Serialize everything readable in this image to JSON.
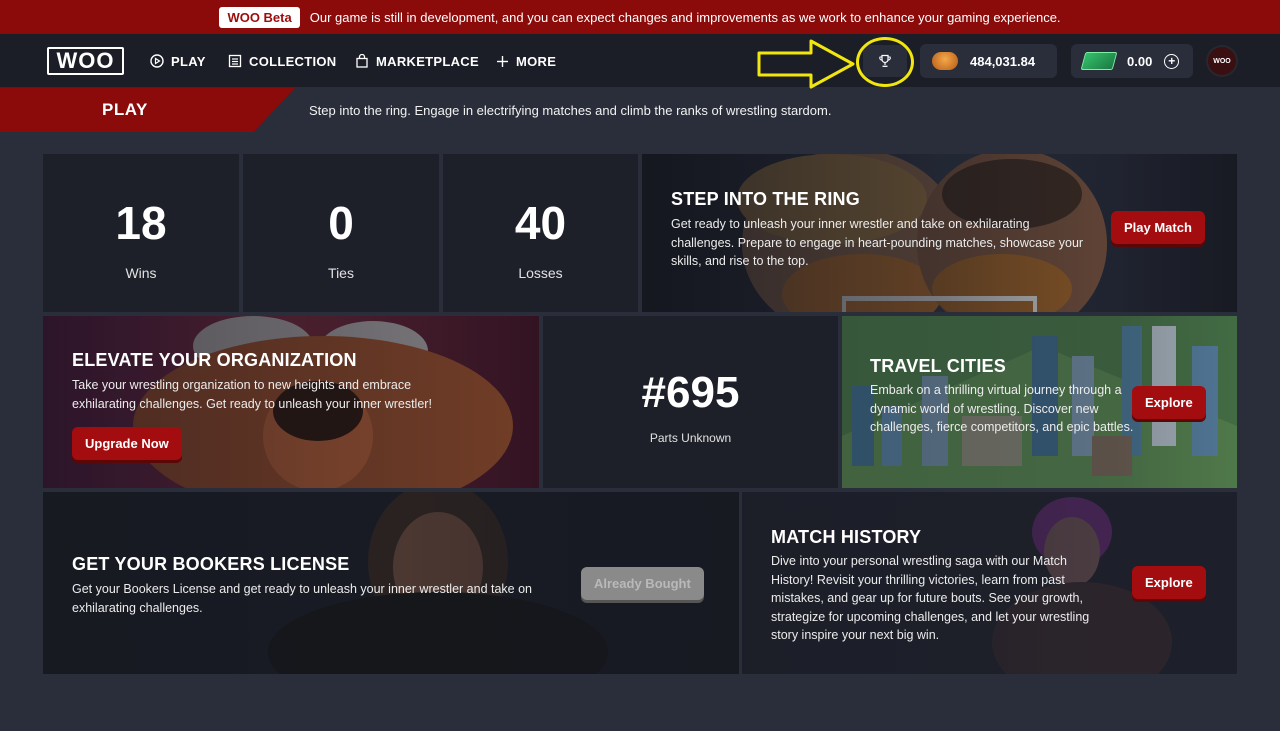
{
  "beta": {
    "badge": "WOO Beta",
    "message": "Our game is still in development, and you can expect changes and improvements as we work to enhance your gaming experience."
  },
  "nav": {
    "logo": "WOO",
    "items": [
      {
        "label": "PLAY",
        "icon": "play-circle-icon"
      },
      {
        "label": "COLLECTION",
        "icon": "collection-icon"
      },
      {
        "label": "MARKETPLACE",
        "icon": "shopping-bag-icon"
      },
      {
        "label": "MORE",
        "icon": "plus-icon"
      }
    ],
    "trophy_icon": "trophy-icon",
    "coins": "484,031.84",
    "cash": "0.00",
    "avatar_text": "WOO"
  },
  "page": {
    "title": "PLAY",
    "subtitle": "Step into the ring. Engage in electrifying matches and climb the ranks of wrestling stardom."
  },
  "stats": {
    "wins": {
      "value": "18",
      "label": "Wins"
    },
    "ties": {
      "value": "0",
      "label": "Ties"
    },
    "losses": {
      "value": "40",
      "label": "Losses"
    }
  },
  "step_ring": {
    "title": "STEP INTO THE RING",
    "text": "Get ready to unleash your inner wrestler and take on exhilarating challenges. Prepare to engage in heart-pounding matches, showcase your skills, and rise to the top.",
    "button": "Play Match"
  },
  "organization": {
    "title": "ELEVATE YOUR ORGANIZATION",
    "text": "Take your wrestling organization to new heights and embrace exhilarating challenges. Get ready to unleash your inner wrestler!",
    "button": "Upgrade Now"
  },
  "rank": {
    "value": "#695",
    "label": "Parts Unknown"
  },
  "travel": {
    "title": "TRAVEL CITIES",
    "text": "Embark on a thrilling virtual journey through a dynamic world of wrestling. Discover new challenges, fierce competitors, and epic battles.",
    "button": "Explore"
  },
  "bookers": {
    "title": "GET YOUR BOOKERS LICENSE",
    "text": "Get your Bookers License and get ready to unleash your inner wrestler and take on exhilarating challenges.",
    "button": "Already Bought"
  },
  "history": {
    "title": "MATCH HISTORY",
    "text": "Dive into your personal wrestling saga with our Match History! Revisit your thrilling victories, learn from past mistakes, and gear up for future bouts. See your growth, strategize for upcoming challenges, and let your wrestling story inspire your next big win.",
    "button": "Explore"
  },
  "colors": {
    "brand_red": "#8b0a0a",
    "button_red": "#a30d10",
    "page_bg": "#2a2d3a",
    "card_bg": "#1d1f29",
    "annotation_yellow": "#f2e60f"
  }
}
